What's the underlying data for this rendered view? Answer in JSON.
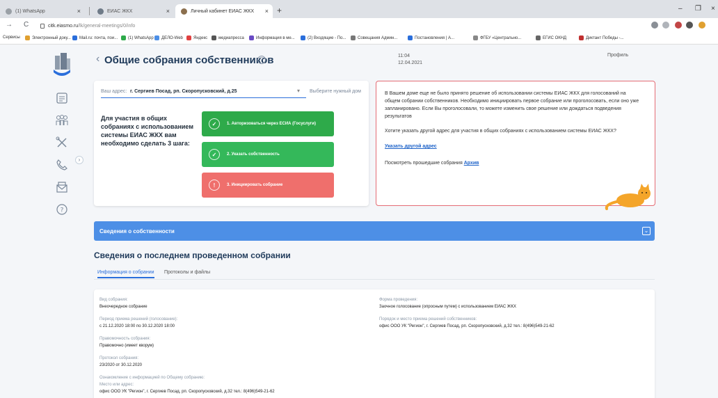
{
  "browser": {
    "tabs": [
      {
        "label": "(1) WhatsApp",
        "color": "#9aa0a6"
      },
      {
        "label": "ЕИАС ЖКХ",
        "color": "#6f7b88"
      },
      {
        "label": "Личный кабинет ЕИАС ЖКХ",
        "color": "#8b6f4e"
      }
    ],
    "url_host": "citk.eiasmo.ru",
    "url_path": "/lk/general-meetings/0/info",
    "bookmarks": [
      {
        "label": "Сервисы",
        "color": "#cccccc"
      },
      {
        "label": "Электронный доку...",
        "color": "#e0a030"
      },
      {
        "label": "Mail.ru: почта, пои...",
        "color": "#2a6edb"
      },
      {
        "label": "(1) WhatsApp",
        "color": "#2eaa4a"
      },
      {
        "label": "ДЕЛО-Web",
        "color": "#4d8fe6"
      },
      {
        "label": "Яндекс",
        "color": "#e04040"
      },
      {
        "label": "медиапресса",
        "color": "#555555"
      },
      {
        "label": "Информация в ме...",
        "color": "#6a4bc4"
      },
      {
        "label": "(2) Входящие - По...",
        "color": "#2a6edb"
      },
      {
        "label": "Совещания Админ...",
        "color": "#777777"
      },
      {
        "label": "Постановления | А...",
        "color": "#2a6edb"
      },
      {
        "label": "ФГБУ «Центрально...",
        "color": "#888888"
      },
      {
        "label": "ЕГИС ОКНД",
        "color": "#666666"
      },
      {
        "label": "Диктант Победы -...",
        "color": "#c03030"
      }
    ]
  },
  "header": {
    "title": "Общие собрания собственников",
    "help": "?",
    "time": "11:04",
    "date": "12.04.2021",
    "profile": "Профиль"
  },
  "sidebar": {
    "items": [
      {
        "name": "dashboard-icon"
      },
      {
        "name": "people-icon"
      },
      {
        "name": "tools-icon"
      },
      {
        "name": "phone-icon"
      },
      {
        "name": "mail-icon"
      },
      {
        "name": "help-icon"
      }
    ],
    "toggle": "›"
  },
  "address": {
    "label": "Ваш адрес:",
    "value": "г. Сергиев Посад, рп. Скоропусковский, д.25",
    "hint": "Выберите нужный дом"
  },
  "steps": {
    "intro": "Для участия в общих собраниях с использованием системы ЕИАС ЖКХ вам необходимо сделать 3 шага:",
    "items": [
      {
        "label": "1. Авторизоваться через ЕСИА (Госуслуги)",
        "icon": "✓"
      },
      {
        "label": "2. Указать собственность",
        "icon": "✓"
      },
      {
        "label": "3. Инициировать собрание",
        "icon": "!"
      }
    ]
  },
  "notice": {
    "text": "В Вашем доме еще не было принято решение об использовании системы ЕИАС ЖКХ для голосований на общем собрании собственников. Необходимо инициировать первое собрание или проголосовать, если оно уже запланировано. Если Вы проголосовали, то можете изменить свое решение или дождаться подведения результатов",
    "question": "Хотите указать другой адрес для участия в общих собраниях с использованием системы ЕИАС ЖКХ?",
    "link": "Указать другой адрес",
    "past_text": "Посмотреть прошедшие собрания",
    "past_link": "Архив"
  },
  "ownership": {
    "title": "Сведения о собственности",
    "chevron": "⌄"
  },
  "meeting": {
    "title": "Сведения о последнем проведенном собрании",
    "tabs": [
      "Информация о собрании",
      "Протоколы и файлы"
    ],
    "fields_left": [
      {
        "label": "Вид собрания:",
        "value": "Внеочередное собрание"
      },
      {
        "label": "Период приема решений (голосование):",
        "value": "с 21.12.2020 18:00 по 30.12.2020 18:00"
      },
      {
        "label": "Правомочность собрания:",
        "value": "Правомочно (имеет кворум)"
      },
      {
        "label": "Протокол собрания:",
        "value": "23/2020 от 30.12.2020"
      }
    ],
    "fields_right": [
      {
        "label": "Форма проведения:",
        "value": "Заочное голосование (опросным путем) с использованием ЕИАС ЖКХ"
      },
      {
        "label": "Порядок и место приема решений собственников:",
        "value": "офис ООО УК \"Регион\", г. Сергиев Посад, рп. Скоропусковский, д.32 тел.: 8(496)549-21-62"
      }
    ],
    "familiar": {
      "label": "Ознакомление с информацией по Общему собранию:",
      "place_label": "Место или адрес:",
      "place_value": "офис ООО УК \"Регион\", г. Сергиев Посад, рп. Скоропусковский, д.32 тел.: 8(496)549-21-62"
    }
  },
  "colors": {
    "accent": "#2a6edb",
    "step_done": "#2eaa4a",
    "step_todo": "#ef6f6c",
    "band": "#4d8fe6",
    "notice_border": "#e46c74"
  }
}
